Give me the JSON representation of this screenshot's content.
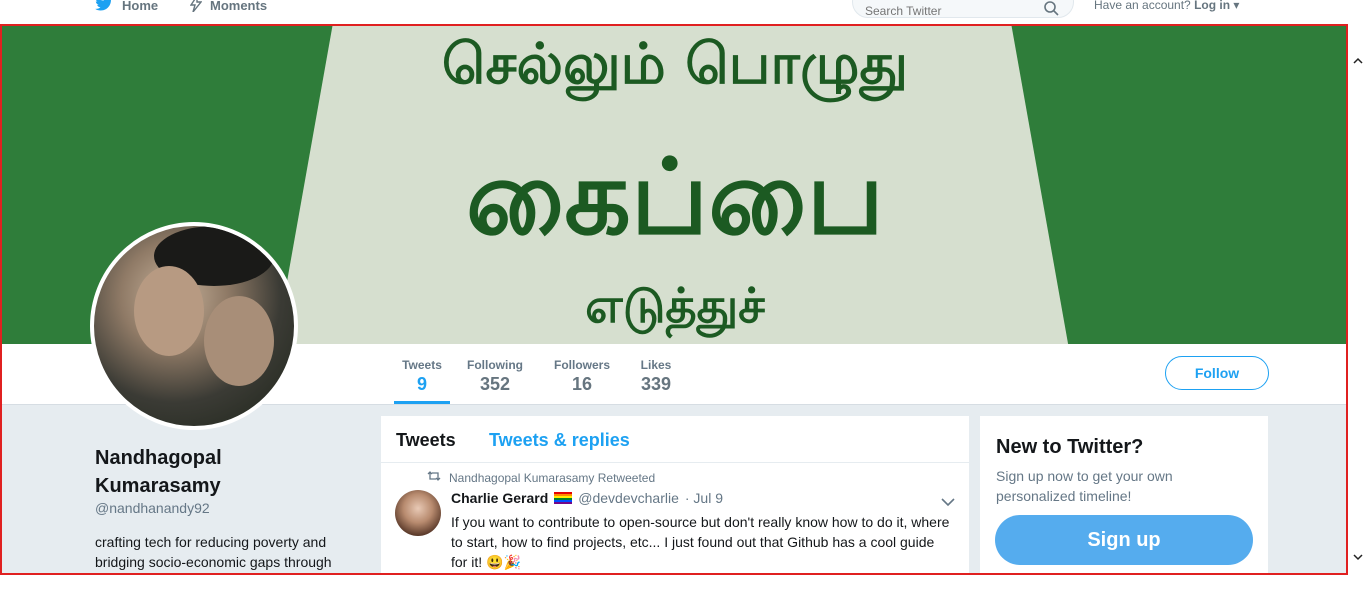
{
  "nav": {
    "home": "Home",
    "moments": "Moments",
    "search_placeholder": "Search Twitter",
    "account_prompt": "Have an account?",
    "login": "Log in"
  },
  "banner": {
    "line1": "செல்லும் பொழுது",
    "line2": "கைப்பை",
    "line3": "எடுத்துச்"
  },
  "profile": {
    "name": "Nandhagopal Kumarasamy",
    "handle": "@nandhanandy92",
    "bio": "crafting tech for reducing poverty and bridging socio-economic gaps through"
  },
  "stats": [
    {
      "label": "Tweets",
      "value": "9"
    },
    {
      "label": "Following",
      "value": "352"
    },
    {
      "label": "Followers",
      "value": "16"
    },
    {
      "label": "Likes",
      "value": "339"
    }
  ],
  "follow_label": "Follow",
  "timeline": {
    "tabs": [
      "Tweets",
      "Tweets & replies"
    ],
    "retweet_by": "Nandhagopal Kumarasamy Retweeted",
    "tweet": {
      "name": "Charlie Gerard",
      "handle": "@devdevcharlie",
      "date": "· Jul 9",
      "text": "If you want to contribute to open-source but don't really know how to do it, where to start, how to find projects, etc... I just found out that Github has a cool guide for it! 😃🎉"
    }
  },
  "signup": {
    "title": "New to Twitter?",
    "text": "Sign up now to get your own personalized timeline!",
    "button": "Sign up"
  },
  "colors": {
    "accent": "#1da1f2",
    "banner_green": "#2f7d3a",
    "frame_red": "#e02020"
  }
}
